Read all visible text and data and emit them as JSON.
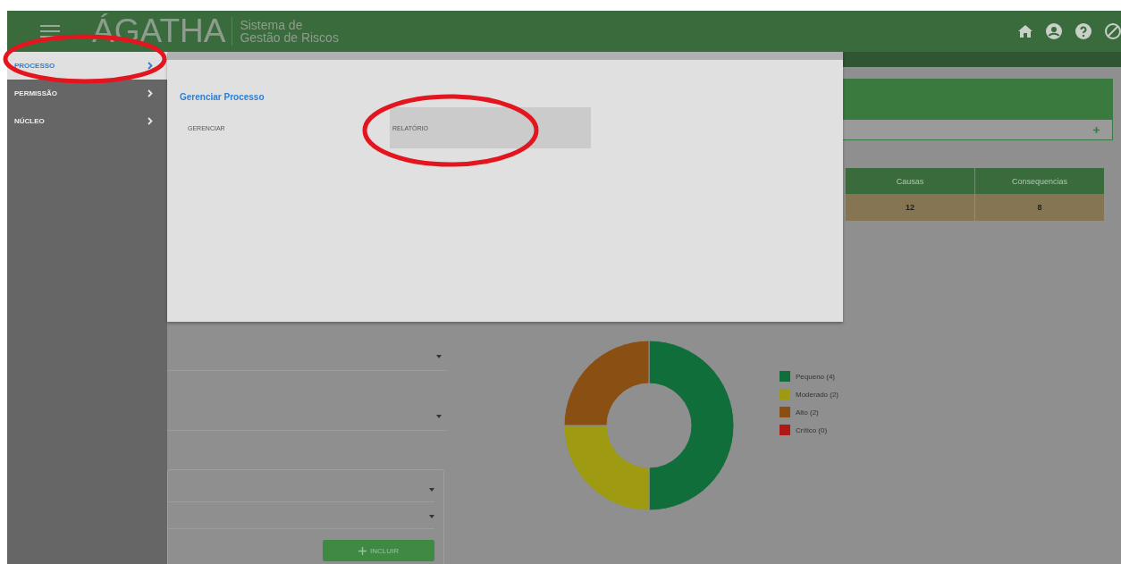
{
  "header": {
    "logo": "ÁGATHA",
    "subtitle": [
      "Sistema de",
      "Gestão de Riscos"
    ]
  },
  "sidebar": {
    "items": [
      {
        "label": "PROCESSO",
        "selected": true
      },
      {
        "label": "PERMISSÃO",
        "selected": false
      },
      {
        "label": "NÚCLEO",
        "selected": false
      }
    ]
  },
  "menu_panel": {
    "title": "Gerenciar Processo",
    "items": [
      {
        "label": "GERENCIAR",
        "selected": false
      },
      {
        "label": "RELATÓRIO",
        "selected": true
      }
    ]
  },
  "summary_table": {
    "columns": [
      "Causas",
      "Consequencias"
    ],
    "rows": [
      [
        "12",
        "8"
      ]
    ]
  },
  "risk_chart": {
    "chart_data": {
      "type": "donut",
      "categories": [
        "Pequeno (4)",
        "Moderado (2)",
        "Alto (2)",
        "Crítico (0)"
      ],
      "series": [
        {
          "values": [
            4,
            2,
            2,
            0
          ]
        }
      ],
      "colors": [
        "#0f6e3a",
        "#9e9a12",
        "#8a4f12",
        "#b01818"
      ]
    }
  },
  "form": {
    "button": "INCLUIR"
  }
}
